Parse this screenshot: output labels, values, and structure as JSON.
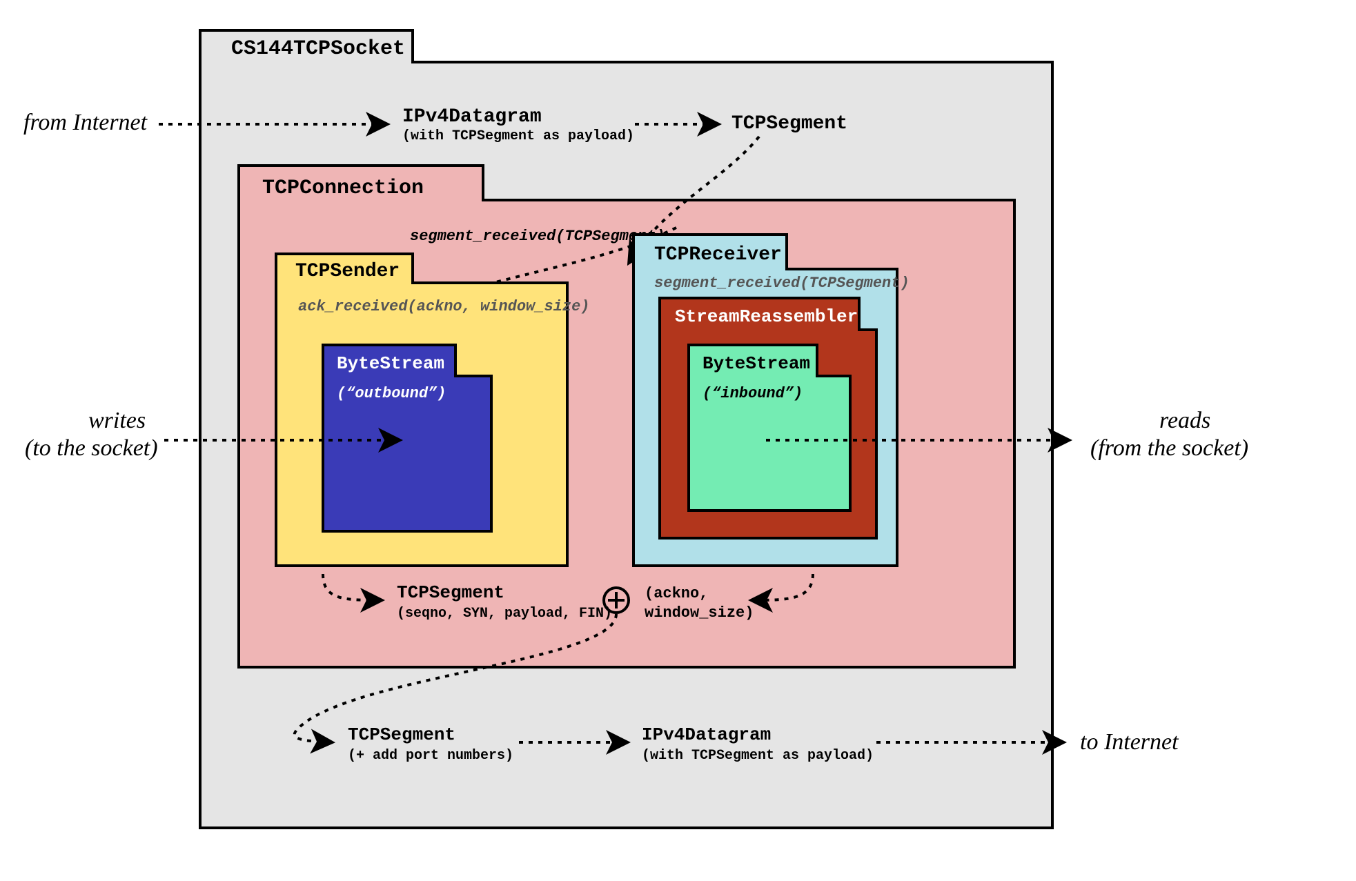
{
  "boxes": {
    "socket": {
      "title": "CS144TCPSocket"
    },
    "connection": {
      "title": "TCPConnection"
    },
    "sender": {
      "title": "TCPSender",
      "fn": "ack_received(ackno, window_size)"
    },
    "receiver": {
      "title": "TCPReceiver",
      "fn": "segment_received(TCPSegment)"
    },
    "reassembler": {
      "title": "StreamReassembler"
    },
    "bs_out": {
      "title": "ByteStream",
      "sub": "(“outbound”)"
    },
    "bs_in": {
      "title": "ByteStream",
      "sub": "(“inbound”)"
    }
  },
  "labels": {
    "from_internet": "from Internet",
    "to_internet": "to Internet",
    "writes_l1": "writes",
    "writes_l2": "(to the socket)",
    "reads_l1": "reads",
    "reads_l2": "(from the socket)",
    "ipv4_in_l1": "IPv4Datagram",
    "ipv4_in_l2": "(with TCPSegment as payload)",
    "tcpseg_in": "TCPSegment",
    "seg_recv_fn": "segment_received(TCPSegment)",
    "tcpseg_out_l1": "TCPSegment",
    "tcpseg_out_l2": "(seqno, SYN, payload, FIN)",
    "ack_l1": "(ackno,",
    "ack_l2": "window_size)",
    "tcpseg_btm_l1": "TCPSegment",
    "tcpseg_btm_l2": "(+ add port numbers)",
    "ipv4_btm_l1": "IPv4Datagram",
    "ipv4_btm_l2": "(with TCPSegment as payload)"
  },
  "colors": {
    "socket_fill": "#e5e5e5",
    "conn_fill": "#efb5b5",
    "sender_fill": "#ffe37a",
    "recv_fill": "#b1e0e9",
    "reasm_fill": "#b2361c",
    "bs_out_fill": "#3a3bb7",
    "bs_in_fill": "#74ecb3"
  }
}
